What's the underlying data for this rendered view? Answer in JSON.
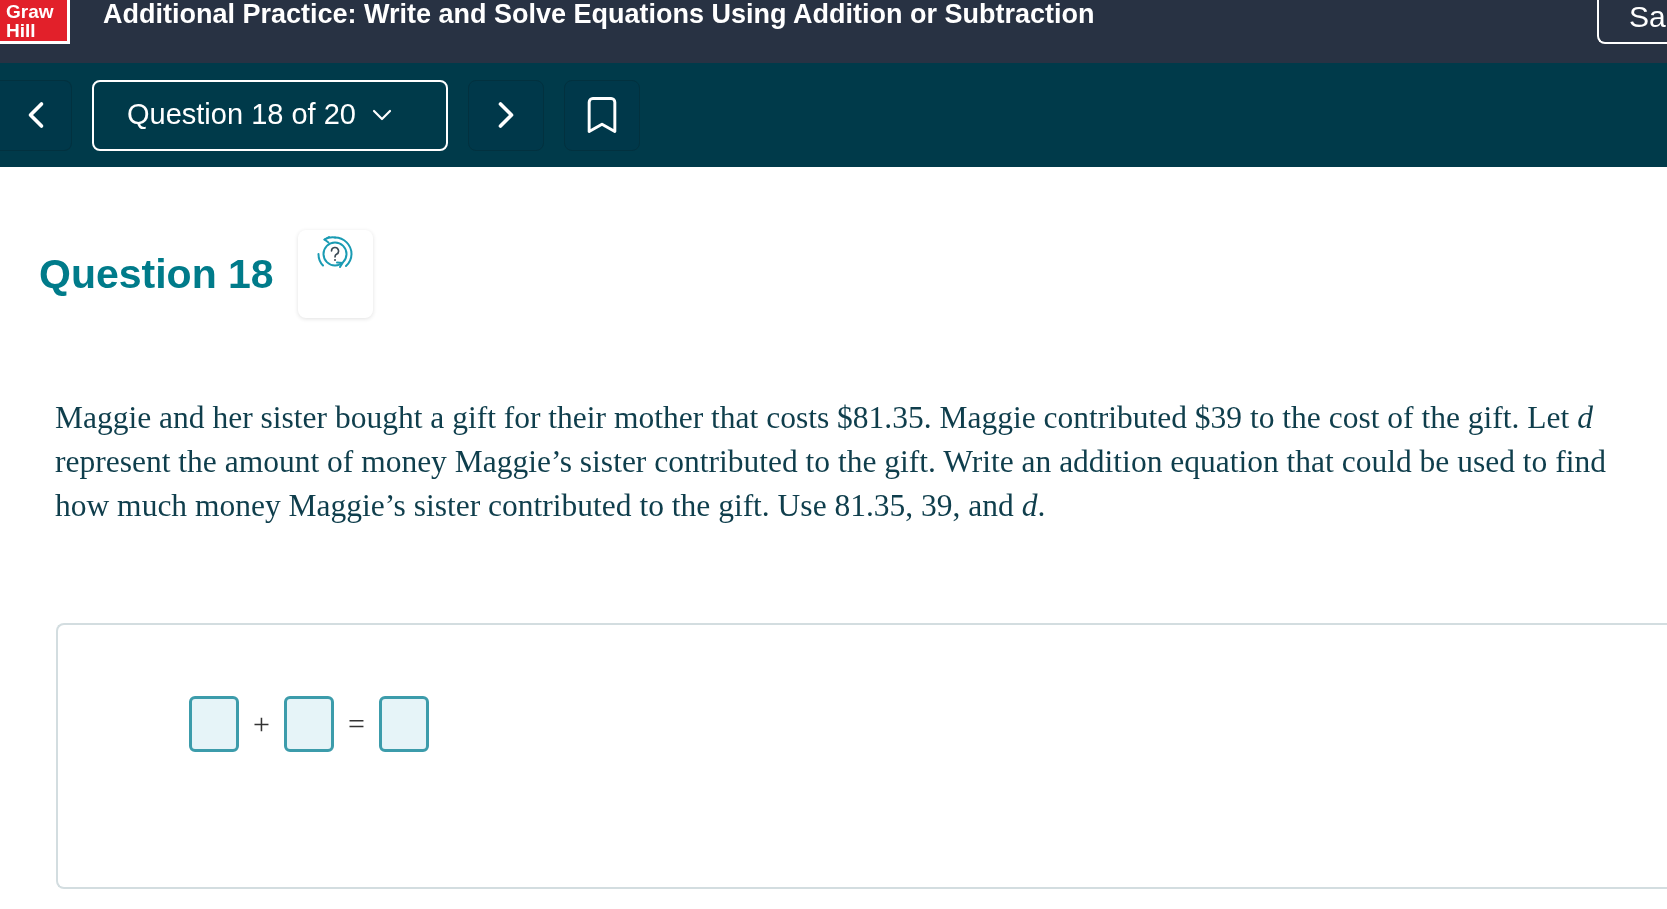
{
  "header": {
    "logo": {
      "line_1": "Graw",
      "line_2": "Hill"
    },
    "title": "Additional Practice: Write and Solve Equations Using Addition or Subtraction",
    "save_button": "Sa"
  },
  "nav": {
    "question_menu": "Question 18 of 20"
  },
  "question": {
    "heading": "Question 18",
    "prompt": "Maggie and her sister bought a gift for their mother that costs $81.35. Maggie contributed $39 to the cost of the gift. Let *d* represent the amount of money Maggie’s sister contributed to the gift. Write an addition equation that could be used to find how much money Maggie’s sister contributed to the gift. Use 81.35, 39, and *d*.",
    "equation": [
      {
        "kind": "blank"
      },
      {
        "kind": "operator",
        "text": "+"
      },
      {
        "kind": "blank"
      },
      {
        "kind": "operator",
        "text": "="
      },
      {
        "kind": "blank"
      }
    ]
  }
}
